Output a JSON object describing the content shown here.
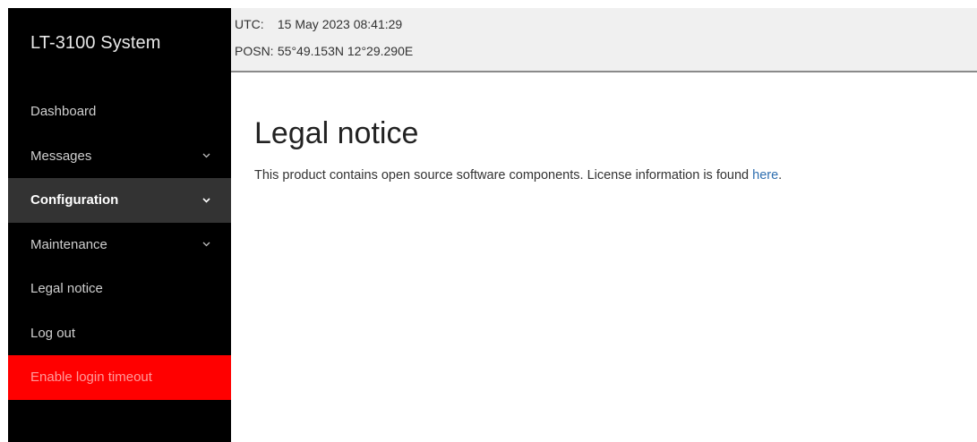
{
  "sidebar": {
    "brand": "LT-3100 System",
    "items": [
      {
        "label": "Dashboard",
        "has_submenu": false
      },
      {
        "label": "Messages",
        "has_submenu": true
      },
      {
        "label": "Configuration",
        "has_submenu": true,
        "active": true
      },
      {
        "label": "Maintenance",
        "has_submenu": true
      },
      {
        "label": "Legal notice",
        "has_submenu": false
      },
      {
        "label": "Log out",
        "has_submenu": false
      },
      {
        "label": "Enable login timeout",
        "has_submenu": false,
        "highlight": true
      }
    ]
  },
  "status": {
    "utc_label": "UTC:",
    "utc_value": "15 May 2023 08:41:29",
    "posn_label": "POSN:",
    "posn_value": "55°49.153N 12°29.290E"
  },
  "main": {
    "title": "Legal notice",
    "notice_text": "This product contains open source software components. License information is found ",
    "notice_link": "here",
    "notice_end": "."
  },
  "colors": {
    "sidebar_bg": "#000000",
    "active_bg": "#333333",
    "alert_bg": "#ff0000",
    "link": "#2f6fb0",
    "topbar_bg": "#f0f0f0"
  },
  "icons": {
    "submenu": "chevron-down-icon"
  }
}
